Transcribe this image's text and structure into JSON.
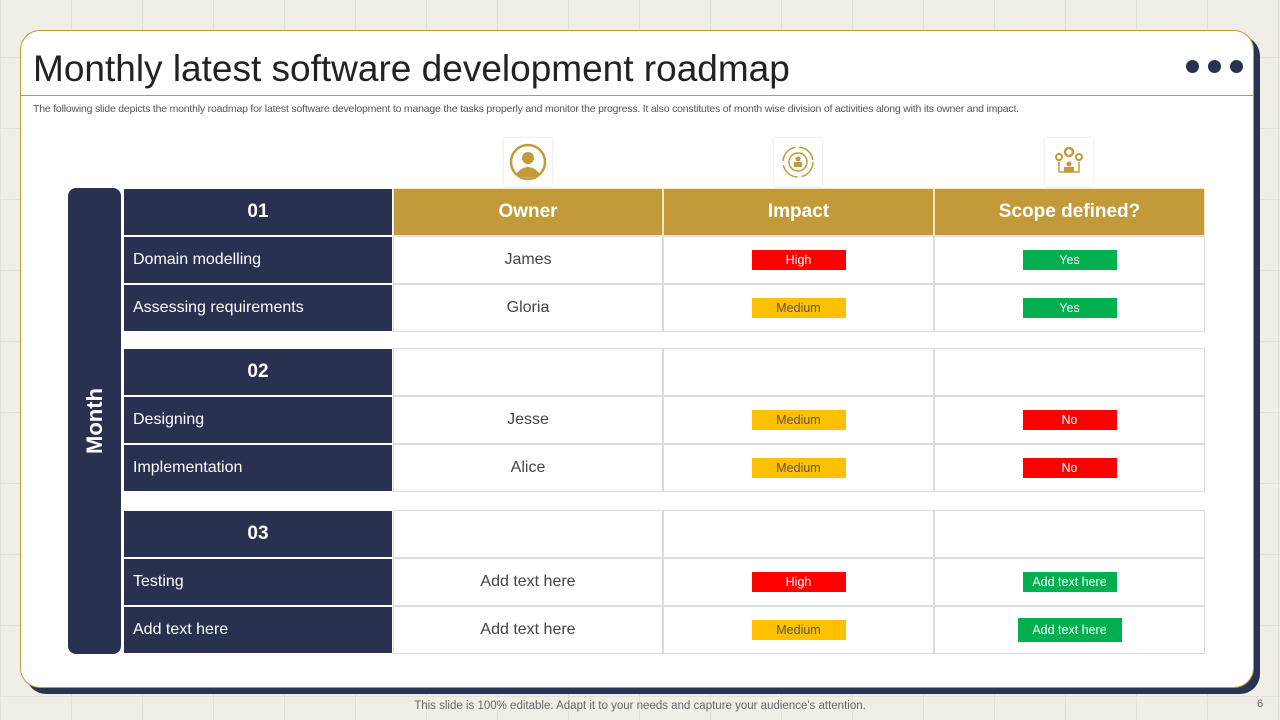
{
  "title": "Monthly latest software development roadmap",
  "subtitle": "The following slide depicts the monthly roadmap for latest software development to manage the tasks properly and monitor the progress. It also constitutes of month wise division of activities along with its owner and impact.",
  "month_label": "Month",
  "columns": [
    "Owner",
    "Impact",
    "Scope defined?"
  ],
  "column_icons": [
    "user-circle-icon",
    "impact-cycle-icon",
    "team-gears-icon"
  ],
  "groups": [
    {
      "label": "01",
      "rows": [
        {
          "task": "Domain modelling",
          "owner": "James",
          "impact": "High",
          "scope": "Yes"
        },
        {
          "task": "Assessing requirements",
          "owner": "Gloria",
          "impact": "Medium",
          "scope": "Yes"
        }
      ]
    },
    {
      "label": "02",
      "rows": [
        {
          "task": "Designing",
          "owner": "Jesse",
          "impact": "Medium",
          "scope": "No"
        },
        {
          "task": "Implementation",
          "owner": "Alice",
          "impact": "Medium",
          "scope": "No"
        }
      ]
    },
    {
      "label": "03",
      "rows": [
        {
          "task": "Testing",
          "owner": "Add text here",
          "impact": "High",
          "scope": "Add text here"
        },
        {
          "task": "Add text here",
          "owner": "Add text here",
          "impact": "Medium",
          "scope": "Add text here"
        }
      ]
    }
  ],
  "colors": {
    "navy": "#283250",
    "gold": "#c29a3a",
    "high": "#ff0000",
    "medium": "#ffc000",
    "green": "#00b050"
  },
  "footer": "This slide is 100% editable. Adapt it to your needs and capture your audience's attention.",
  "page_number": "6"
}
